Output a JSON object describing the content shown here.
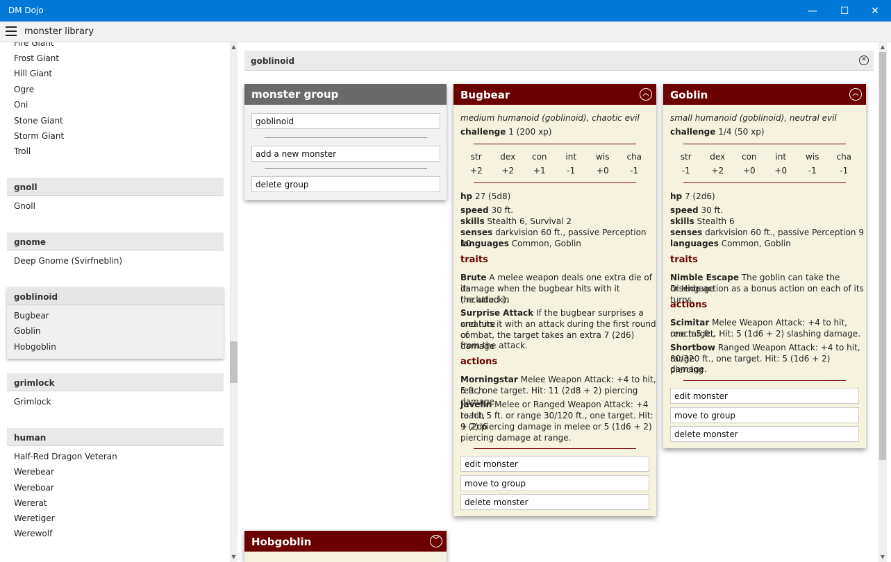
{
  "window": {
    "title": "DM Dojo",
    "minimize": "—",
    "maximize": "☐",
    "close": "✕"
  },
  "appbar": {
    "title": "monster library"
  },
  "sidebar": {
    "giant_items": [
      "Fire Giant",
      "Frost Giant",
      "Hill Giant",
      "Ogre",
      "Oni",
      "Stone Giant",
      "Storm Giant",
      "Troll"
    ],
    "gnoll": {
      "header": "gnoll",
      "items": [
        "Gnoll"
      ]
    },
    "gnome": {
      "header": "gnome",
      "items": [
        "Deep Gnome (Svirfneblin)"
      ]
    },
    "goblinoid": {
      "header": "goblinoid",
      "items": [
        "Bugbear",
        "Goblin",
        "Hobgoblin"
      ]
    },
    "grimlock": {
      "header": "grimlock",
      "items": [
        "Grimlock"
      ]
    },
    "human": {
      "header": "human",
      "items": [
        "Half-Red Dragon Veteran",
        "Werebear",
        "Wereboar",
        "Wererat",
        "Weretiger",
        "Werewolf"
      ]
    }
  },
  "group_bar": {
    "title": "goblinoid"
  },
  "monster_group": {
    "title": "monster group",
    "name_value": "goblinoid",
    "add_label": "add a new monster",
    "delete_label": "delete group"
  },
  "stat_labels": [
    "str",
    "dex",
    "con",
    "int",
    "wis",
    "cha"
  ],
  "bugbear": {
    "name": "Bugbear",
    "type": "medium humanoid (goblinoid), chaotic evil",
    "challenge_label": "challenge",
    "challenge": "1 (200 xp)",
    "stats": [
      "+2",
      "+2",
      "+1",
      "-1",
      "+0",
      "-1"
    ],
    "hp_label": "hp",
    "hp": "27 (5d8)",
    "speed_label": "speed",
    "speed": "30 ft.",
    "skills_label": "skills",
    "skills": "Stealth 6, Survival 2",
    "senses_label": "senses",
    "senses": "darkvision 60 ft., passive Perception 10",
    "languages_label": "languages",
    "languages": "Common, Goblin",
    "traits_header": "traits",
    "trait1_name": "Brute",
    "trait1_l1": " A melee weapon deals one extra die of its",
    "trait1_l2": "damage when the bugbear hits with it (included in",
    "trait1_l3": "the attack).",
    "trait2_name": "Surprise Attack",
    "trait2_l1": " If the bugbear surprises a creature",
    "trait2_l2": "and hits it with an attack during the first round of",
    "trait2_l3": "combat, the target takes an extra 7 (2d6) damage",
    "trait2_l4": "from the attack.",
    "actions_header": "actions",
    "action1_name": "Morningstar",
    "action1_l1": " Melee Weapon Attack: +4 to hit, reach",
    "action1_l2": "5 ft., one target. Hit: 11 (2d8 + 2) piercing damage.",
    "action2_name": "Javelin",
    "action2_l1": " Melee or Ranged Weapon Attack: +4 to hit,",
    "action2_l2": "reach 5 ft. or range 30/120 ft., one target. Hit: 9 (2d6",
    "action2_l3": "+ 2) piercing damage in melee or 5 (1d6 + 2)",
    "action2_l4": "piercing damage at range.",
    "edit_label": "edit monster",
    "move_label": "move to group",
    "delete_label": "delete monster"
  },
  "goblin": {
    "name": "Goblin",
    "type": "small humanoid (goblinoid), neutral evil",
    "challenge_label": "challenge",
    "challenge": "1/4 (50 xp)",
    "stats": [
      "-1",
      "+2",
      "+0",
      "+0",
      "-1",
      "-1"
    ],
    "hp_label": "hp",
    "hp": "7 (2d6)",
    "speed_label": "speed",
    "speed": "30 ft.",
    "skills_label": "skills",
    "skills": "Stealth 6",
    "senses_label": "senses",
    "senses": "darkvision 60 ft., passive Perception 9",
    "languages_label": "languages",
    "languages": "Common, Goblin",
    "traits_header": "traits",
    "trait1_name": "Nimble Escape",
    "trait1_l1": " The goblin can take the Disengage",
    "trait1_l2": "or Hide action as a bonus action on each of its turns.",
    "actions_header": "actions",
    "action1_name": "Scimitar",
    "action1_l1": " Melee Weapon Attack: +4 to hit, reach 5 ft.,",
    "action1_l2": "one target. Hit: 5 (1d6 + 2) slashing damage.",
    "action2_name": "Shortbow",
    "action2_l1": " Ranged Weapon Attack: +4 to hit, range",
    "action2_l2": "80/320 ft., one target. Hit: 5 (1d6 + 2) piercing",
    "action2_l3": "damage.",
    "edit_label": "edit monster",
    "move_label": "move to group",
    "delete_label": "delete monster"
  },
  "hobgoblin": {
    "name": "Hobgoblin"
  },
  "icons": {
    "collapse_up": "︿",
    "collapse_down": "﹀",
    "close": "✕",
    "scroll_up": "▲",
    "scroll_down": "▼"
  },
  "colors": {
    "titlebar": "#0078d7",
    "card_header": "#6b0000",
    "card_bg": "#f5f3dd",
    "group_header": "#6a6a6a"
  }
}
